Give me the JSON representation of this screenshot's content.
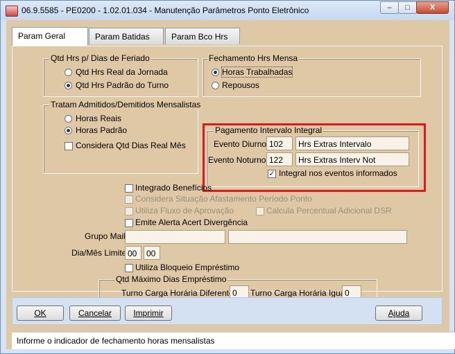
{
  "window": {
    "title": "06.9.5585 - PE0200 - 1.02.01.034 - Manutenção Parâmetros Ponto Eletrônico",
    "min_glyph": "–",
    "max_glyph": "□",
    "close_glyph": "X"
  },
  "tabs": [
    {
      "label": "Param Geral",
      "active": true
    },
    {
      "label": "Param Batidas",
      "active": false
    },
    {
      "label": "Param Bco Hrs",
      "active": false
    }
  ],
  "feriado": {
    "legend": "Qtd Hrs p/ Dias de Feriado",
    "options": [
      {
        "label": "Qtd Hrs Real da Jornada",
        "selected": false
      },
      {
        "label": "Qtd Hrs Padrão do Turno",
        "selected": true
      }
    ]
  },
  "fechamento": {
    "legend": "Fechamento Hrs Mensa",
    "options": [
      {
        "label": "Horas Trabalhadas",
        "selected": true
      },
      {
        "label": "Repousos",
        "selected": false
      }
    ]
  },
  "admitidos": {
    "legend": "Tratam Admitidos/Demitidos Mensalistas",
    "options": [
      {
        "label": "Horas Reais",
        "selected": false
      },
      {
        "label": "Horas Padrão",
        "selected": true
      }
    ],
    "checkbox": {
      "label": "Considera Qtd Dias Real Mês",
      "checked": false
    }
  },
  "pagamento": {
    "legend": "Pagamento Intervalo Integral",
    "diurno": {
      "label": "Evento Diurno:",
      "code": "102",
      "desc": "Hrs Extras Intervalo"
    },
    "noturno": {
      "label": "Evento Noturno:",
      "code": "122",
      "desc": "Hrs Extras Interv Not"
    },
    "checkbox": {
      "label": "Integral nos eventos informados",
      "checked": true,
      "mark": "✓"
    }
  },
  "checks": {
    "integrado": {
      "label": "Integrado Benefícios",
      "checked": false,
      "enabled": true
    },
    "afastamento": {
      "label": "Considera Situação Afastamento Período Ponto",
      "checked": false,
      "enabled": false
    },
    "fluxo": {
      "label": "Utiliza Fluxo de Aprovação",
      "checked": false,
      "enabled": false
    },
    "percentual": {
      "label": "Calcula Percentual Adicional DSR",
      "checked": false,
      "enabled": false
    },
    "alerta": {
      "label": "Emite Alerta Acert Divergência",
      "checked": false,
      "enabled": true
    },
    "bloqueio": {
      "label": "Utiliza Bloqueio Empréstimo",
      "checked": false,
      "enabled": true
    }
  },
  "grupo_mail": {
    "label": "Grupo Mail:",
    "value1": "",
    "value2": ""
  },
  "dia_mes": {
    "label": "Dia/Mês Limite:",
    "dia": "00",
    "mes": "00"
  },
  "emprestimo": {
    "legend": "Qtd Máximo Dias Empréstimo",
    "diferente": {
      "label": "Turno Carga Horária Diferente:",
      "value": "0"
    },
    "igual": {
      "label": "Turno Carga Horária Igual:",
      "value": "0"
    }
  },
  "buttons": {
    "ok": "OK",
    "cancelar": "Cancelar",
    "imprimir": "Imprimir",
    "ajuda": "Ajuda"
  },
  "status": "Informe o indicador de fechamento horas mensalistas",
  "colors": {
    "highlight": "#e01818",
    "panel": "#dfc8a5",
    "window": "#d5e3f3"
  }
}
